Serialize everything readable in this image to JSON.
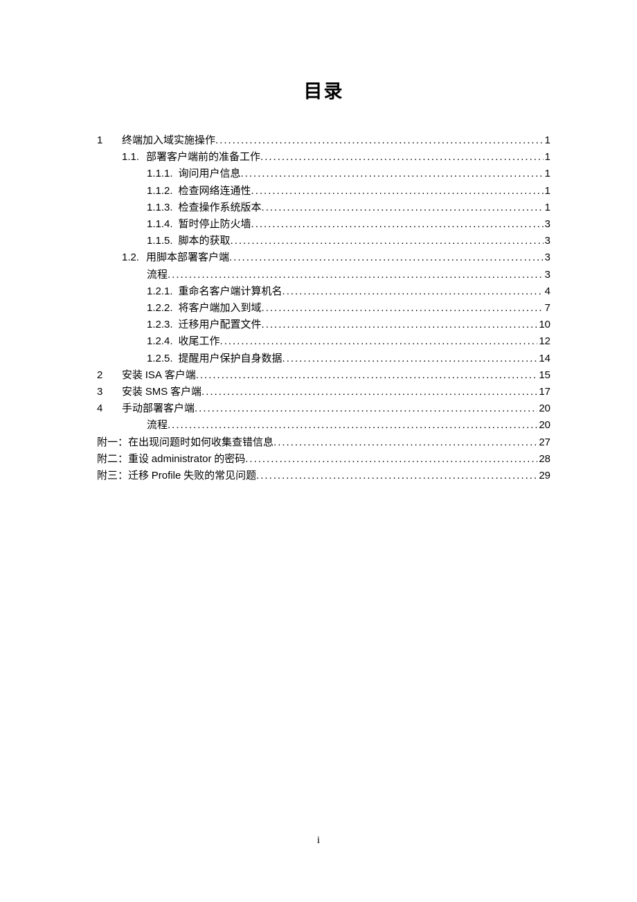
{
  "title": "目录",
  "footerPage": "i",
  "entries": [
    {
      "indent": 0,
      "num": "1",
      "label": "终端加入域实施操作",
      "page": "1"
    },
    {
      "indent": 1,
      "num": "1.1.",
      "label": "部署客户端前的准备工作",
      "page": "1"
    },
    {
      "indent": 2,
      "num": "1.1.1.",
      "label": "询问用户信息",
      "page": "1"
    },
    {
      "indent": 2,
      "num": "1.1.2.",
      "label": "检查网络连通性",
      "page": "1"
    },
    {
      "indent": 2,
      "num": "1.1.3.",
      "label": "检查操作系统版本",
      "page": "1"
    },
    {
      "indent": 2,
      "num": "1.1.4.",
      "label": "暂时停止防火墙",
      "page": "3"
    },
    {
      "indent": 2,
      "num": "1.1.5.",
      "label": "脚本的获取",
      "page": "3"
    },
    {
      "indent": 1,
      "num": "1.2.",
      "label": "用脚本部署客户端",
      "page": "3"
    },
    {
      "indent": 2,
      "num": "",
      "label": "流程",
      "page": "3"
    },
    {
      "indent": 2,
      "num": "1.2.1.",
      "label": "重命名客户端计算机名",
      "page": "4"
    },
    {
      "indent": 2,
      "num": "1.2.2.",
      "label": "将客户端加入到域",
      "page": "7"
    },
    {
      "indent": 2,
      "num": "1.2.3.",
      "label": "迁移用户配置文件",
      "page": "10"
    },
    {
      "indent": 2,
      "num": "1.2.4.",
      "label": "收尾工作",
      "page": "12"
    },
    {
      "indent": 2,
      "num": "1.2.5.",
      "label": "提醒用户保护自身数据",
      "page": "14"
    },
    {
      "indent": 0,
      "num": "2",
      "label": "安装 ISA 客户端",
      "page": "15"
    },
    {
      "indent": 0,
      "num": "3",
      "label": "安装 SMS 客户端",
      "page": "17"
    },
    {
      "indent": 0,
      "num": "4",
      "label": "手动部署客户端",
      "page": "20"
    },
    {
      "indent": 2,
      "num": "",
      "label": "流程",
      "page": "20"
    },
    {
      "indent": 0,
      "num": "附一：",
      "label": "在出现问题时如何收集查错信息",
      "page": "27"
    },
    {
      "indent": 0,
      "num": "附二：",
      "label": "重设 administrator 的密码",
      "page": "28"
    },
    {
      "indent": 0,
      "num": "附三：",
      "label": "迁移 Profile 失败的常见问题",
      "page": "29"
    }
  ]
}
